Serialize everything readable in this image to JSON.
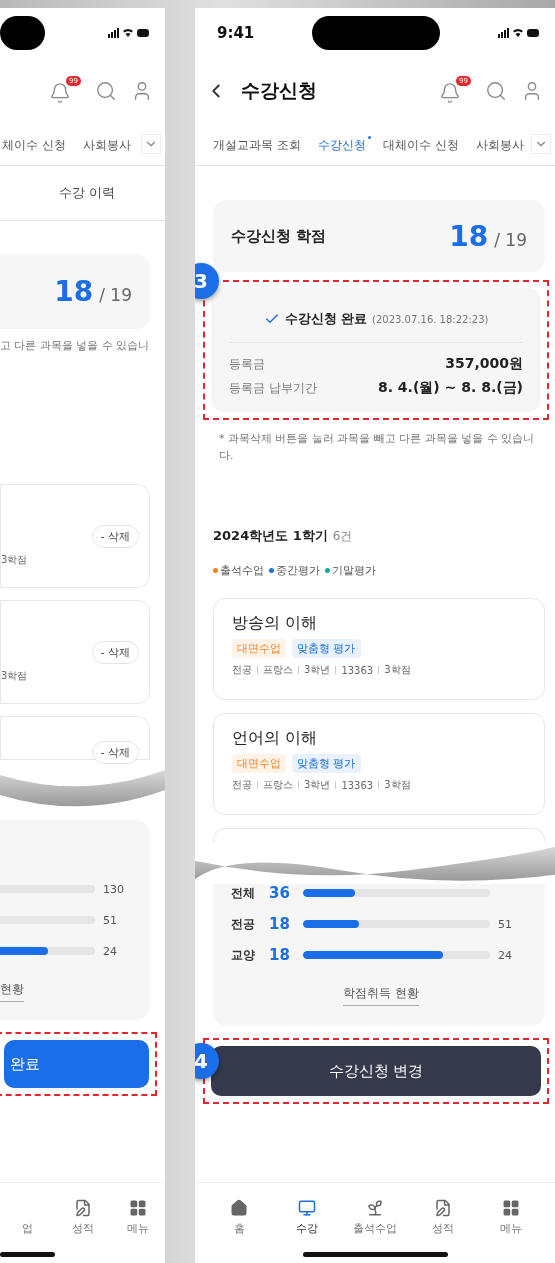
{
  "left_screen": {
    "notification_count": "99",
    "tabs": [
      {
        "label": "체이수 신청",
        "selected": false
      },
      {
        "label": "사회봉사",
        "selected": false
      }
    ],
    "sub_tab": "수강 이력",
    "credits": {
      "value": "18",
      "max": "/ 19"
    },
    "notice": "고 다른 과목을 넣을 수 있습니",
    "courses": [
      {
        "credit": "3학점",
        "action": "- 삭제"
      },
      {
        "credit": "3학점",
        "action": "- 삭제"
      },
      {
        "action": "- 삭제"
      }
    ],
    "bars": [
      {
        "max": "130"
      },
      {
        "max": "51"
      },
      {
        "max": "24",
        "level": 0.75
      }
    ],
    "link": "현황",
    "button": "완료",
    "nav": [
      {
        "label": "업",
        "kind": "attend"
      },
      {
        "label": "성적",
        "kind": "grade"
      },
      {
        "label": "메뉴",
        "kind": "menu"
      }
    ]
  },
  "right_screen": {
    "time": "9:41",
    "title": "수강신청",
    "notification_count": "99",
    "tabs": [
      {
        "label": "개설교과목 조회",
        "selected": false
      },
      {
        "label": "수강신청",
        "selected": true
      },
      {
        "label": "대체이수 신청",
        "selected": false
      },
      {
        "label": "사회봉사",
        "selected": false
      }
    ],
    "credits": {
      "label": "수강신청 학점",
      "value": "18",
      "max": "/ 19"
    },
    "annotation_1": "3",
    "completion": {
      "title": "수강신청 완료",
      "timestamp": "(2023.07.16. 18:22:23)",
      "rows": [
        {
          "label": "등록금",
          "value": "357,000원"
        },
        {
          "label": "등록금 납부기간",
          "value": "8. 4.(월) ~ 8. 8.(금)"
        }
      ]
    },
    "notice": "* 과목삭제 버튼을 눌러 과목을 빼고 다른 과목을 넣을 수 있습니다.",
    "semester": {
      "title": "2024학년도 1학기",
      "count": "6건"
    },
    "legend": [
      {
        "label": "출석수업",
        "color": "#f5821f"
      },
      {
        "label": "중간평가",
        "color": "#1a6ee8"
      },
      {
        "label": "기말평가",
        "color": "#13a89e"
      }
    ],
    "courses": [
      {
        "name": "방송의 이해",
        "tags": [
          {
            "label": "대면수업",
            "kind": "delivery"
          },
          {
            "label": "맞춤형 평가",
            "kind": "assessment"
          }
        ],
        "meta": [
          "전공",
          "프랑스",
          "3학년",
          "13363",
          "3학점"
        ]
      },
      {
        "name": "언어의 이해",
        "tags": [
          {
            "label": "대면수업",
            "kind": "delivery"
          },
          {
            "label": "맞춤형 평가",
            "kind": "assessment"
          }
        ],
        "meta": [
          "전공",
          "프랑스",
          "3학년",
          "13363",
          "3학점"
        ]
      }
    ],
    "bars": [
      {
        "label": "전체",
        "value": "36",
        "level": 0.28
      },
      {
        "label": "전공",
        "value": "18",
        "max": "51",
        "level": 0.3
      },
      {
        "label": "교양",
        "value": "18",
        "max": "24",
        "level": 0.75
      }
    ],
    "link": "학점취득 현황",
    "annotation_2": "4",
    "button": "수강신청 변경",
    "nav": [
      {
        "label": "홈",
        "kind": "home",
        "selected": false
      },
      {
        "label": "수강",
        "kind": "class",
        "selected": true
      },
      {
        "label": "출석수업",
        "kind": "attend",
        "selected": false
      },
      {
        "label": "성적",
        "kind": "grade",
        "selected": false
      },
      {
        "label": "메뉴",
        "kind": "menu",
        "selected": false
      }
    ]
  }
}
